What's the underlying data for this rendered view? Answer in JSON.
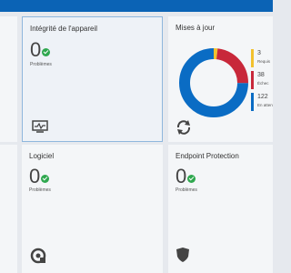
{
  "tiles": {
    "device_health": {
      "title": "Intégrité de l'appareil",
      "count": "0",
      "label": "Problèmes"
    },
    "updates": {
      "title": "Mises à jour",
      "legend": [
        {
          "value": "3",
          "label": "Requis",
          "color": "#f2c12e"
        },
        {
          "value": "38",
          "label": "Échec",
          "color": "#c8283a"
        },
        {
          "value": "122",
          "label": "En attente",
          "color": "#0a6cc4"
        }
      ]
    },
    "software": {
      "title": "Logiciel",
      "count": "0",
      "label": "Problèmes"
    },
    "endpoint": {
      "title": "Endpoint Protection",
      "count": "0",
      "label": "Problèmes"
    }
  },
  "chart_data": {
    "type": "pie",
    "title": "Mises à jour",
    "categories": [
      "Requis",
      "Échec",
      "En attente"
    ],
    "values": [
      3,
      38,
      122
    ],
    "colors": [
      "#f2c12e",
      "#c8283a",
      "#0a6cc4"
    ]
  },
  "icons": {
    "device_health": "monitor-pulse-icon",
    "updates": "refresh-icon",
    "software": "software-gear-icon",
    "endpoint": "shield-icon"
  }
}
